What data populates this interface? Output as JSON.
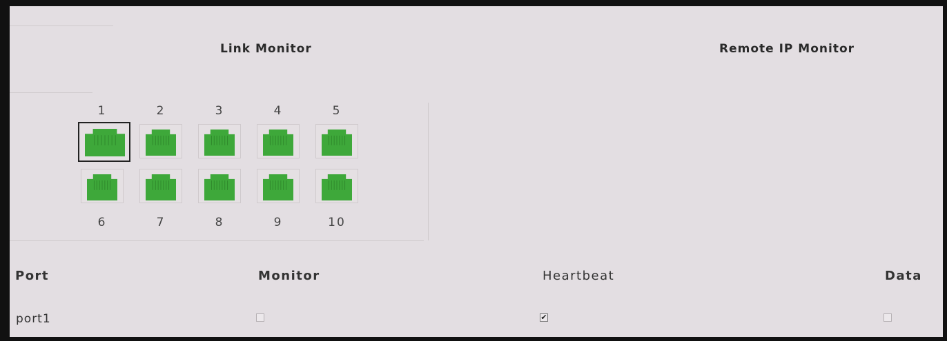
{
  "link_monitor": {
    "title": "Link Monitor",
    "ports_top": [
      {
        "label": "1",
        "selected": true
      },
      {
        "label": "2",
        "selected": false
      },
      {
        "label": "3",
        "selected": false
      },
      {
        "label": "4",
        "selected": false
      },
      {
        "label": "5",
        "selected": false
      }
    ],
    "ports_bottom": [
      {
        "label": "6",
        "selected": false
      },
      {
        "label": "7",
        "selected": false
      },
      {
        "label": "8",
        "selected": false
      },
      {
        "label": "9",
        "selected": false
      },
      {
        "label": "10",
        "selected": false
      }
    ],
    "port_color": "#3ea83a"
  },
  "remote_ip_monitor": {
    "title": "Remote IP Monitor"
  },
  "table": {
    "headers": {
      "port": "Port",
      "monitor": "Monitor",
      "heartbeat": "Heartbeat",
      "data": "Data"
    },
    "rows": [
      {
        "port": "port1",
        "monitor": false,
        "heartbeat": true,
        "data": false
      }
    ]
  },
  "icons": {
    "port_jack": "ethernet-port-icon",
    "check": "checkmark-icon"
  }
}
